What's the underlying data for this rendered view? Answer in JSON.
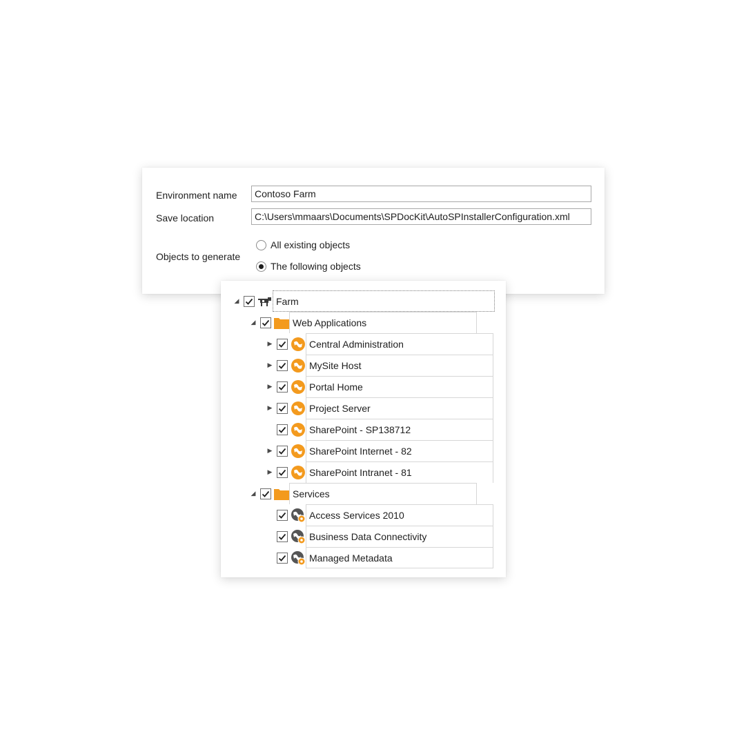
{
  "form": {
    "env_label": "Environment name",
    "env_value": "Contoso Farm",
    "save_label": "Save location",
    "save_value": "C:\\Users\\mmaars\\Documents\\SPDocKit\\AutoSPInstallerConfiguration.xml",
    "objects_label": "Objects to generate",
    "option_all": "All existing objects",
    "option_following": "The following objects",
    "selected_option": "The following objects"
  },
  "tree": {
    "farm": {
      "label": "Farm",
      "checked": true,
      "icon": "farm-icon"
    },
    "web_applications": {
      "label": "Web Applications",
      "checked": true,
      "icon": "folder-icon",
      "items": [
        {
          "label": "Central Administration",
          "checked": true,
          "expandable": true,
          "icon": "web-application-icon"
        },
        {
          "label": "MySite Host",
          "checked": true,
          "expandable": true,
          "icon": "web-application-icon"
        },
        {
          "label": "Portal Home",
          "checked": true,
          "expandable": true,
          "icon": "web-application-icon"
        },
        {
          "label": "Project Server",
          "checked": true,
          "expandable": true,
          "icon": "web-application-icon"
        },
        {
          "label": "SharePoint - SP138712",
          "checked": true,
          "expandable": false,
          "icon": "web-application-icon"
        },
        {
          "label": "SharePoint Internet - 82",
          "checked": true,
          "expandable": true,
          "icon": "web-application-icon"
        },
        {
          "label": "SharePoint Intranet - 81",
          "checked": true,
          "expandable": true,
          "icon": "web-application-icon"
        }
      ]
    },
    "services": {
      "label": "Services",
      "checked": true,
      "icon": "folder-icon",
      "items": [
        {
          "label": "Access Services 2010",
          "checked": true,
          "icon": "service-icon"
        },
        {
          "label": "Business Data Connectivity",
          "checked": true,
          "icon": "service-icon"
        },
        {
          "label": "Managed Metadata",
          "checked": true,
          "icon": "service-icon"
        }
      ]
    }
  },
  "colors": {
    "accent_orange": "#f39a1e",
    "service_gray": "#555555",
    "border": "#d6d6d6"
  }
}
